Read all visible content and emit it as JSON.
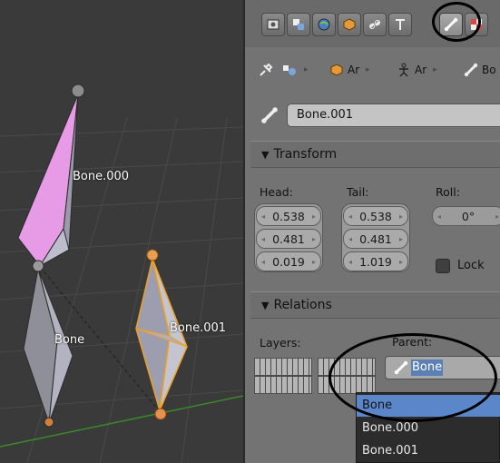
{
  "viewport": {
    "bones": [
      {
        "name": "Bone.000",
        "selected": false
      },
      {
        "name": "Bone",
        "selected": false
      },
      {
        "name": "Bone.001",
        "selected": true
      }
    ]
  },
  "properties": {
    "tabs": [
      {
        "icon": "render-icon"
      },
      {
        "icon": "render-layers-icon"
      },
      {
        "icon": "world-icon"
      },
      {
        "icon": "object-icon"
      },
      {
        "icon": "constraint-icon"
      },
      {
        "icon": "modifier-icon"
      },
      {
        "icon": "bone-icon",
        "active": true
      },
      {
        "icon": "texture-icon"
      }
    ],
    "breadcrumb": [
      {
        "icon": "pin-icon",
        "label": ""
      },
      {
        "icon": "scene-icon",
        "label": ""
      },
      {
        "icon": "object-cube-icon",
        "label": "Ar"
      },
      {
        "icon": "armature-icon",
        "label": "Ar"
      },
      {
        "icon": "bone-icon",
        "label": "Bo"
      }
    ],
    "bone_name": "Bone.001",
    "transform": {
      "header": "Transform",
      "head_label": "Head:",
      "tail_label": "Tail:",
      "roll_label": "Roll:",
      "head": [
        "0.538",
        "0.481",
        "0.019"
      ],
      "tail": [
        "0.538",
        "0.481",
        "1.019"
      ],
      "roll": "0°",
      "lock_label": "Lock",
      "lock_checked": false
    },
    "relations": {
      "header": "Relations",
      "layers_label": "Layers:",
      "parent_label": "Parent:",
      "parent_value": "Bone"
    },
    "parent_dropdown": {
      "options": [
        "Bone",
        "Bone.000",
        "Bone.001"
      ],
      "selected": "Bone"
    }
  },
  "colors": {
    "selected_bone_outline": "#f0a020",
    "active_bone_fill": "#f08cf0",
    "panel_bg": "#737373",
    "dropdown_highlight": "#5b86c9"
  }
}
